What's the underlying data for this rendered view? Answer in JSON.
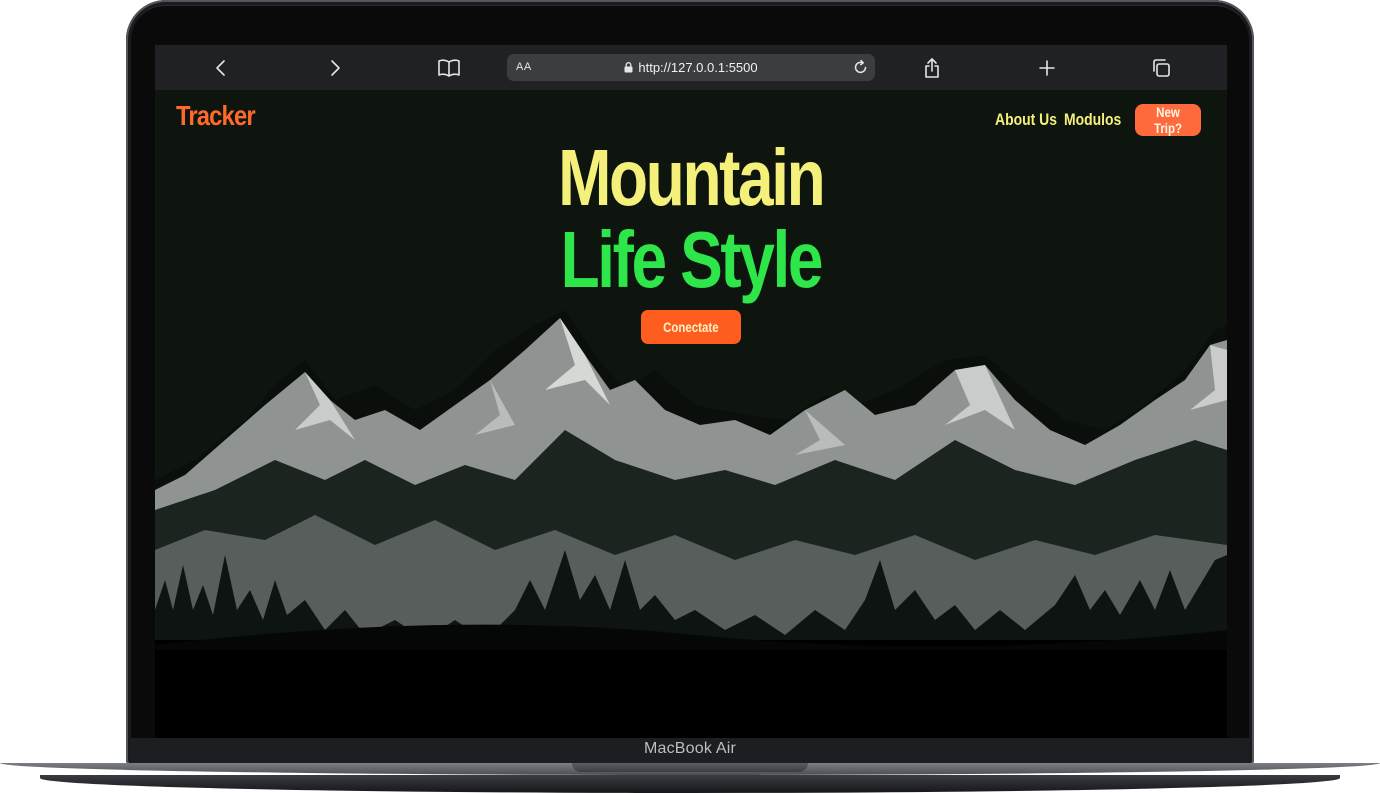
{
  "device": {
    "label": "MacBook Air"
  },
  "browser": {
    "text_size_label": "AA",
    "url": "http://127.0.0.1:5500"
  },
  "site": {
    "logo": "Tracker",
    "nav": {
      "about": "About Us",
      "modulos": "Modulos",
      "new_trip": "New Trip?"
    },
    "hero": {
      "line1": "Mountain",
      "line2": "Life Style",
      "cta": "Conectate"
    }
  },
  "colors": {
    "page_bg": "#0d150e",
    "logo": "#ff6a2b",
    "nav_text": "#f4f07a",
    "hero_line1": "#f4f07a",
    "hero_line2": "#2ee54a",
    "cta_bg": "#ff5c1f",
    "new_trip_bg": "#ff6a3d"
  }
}
